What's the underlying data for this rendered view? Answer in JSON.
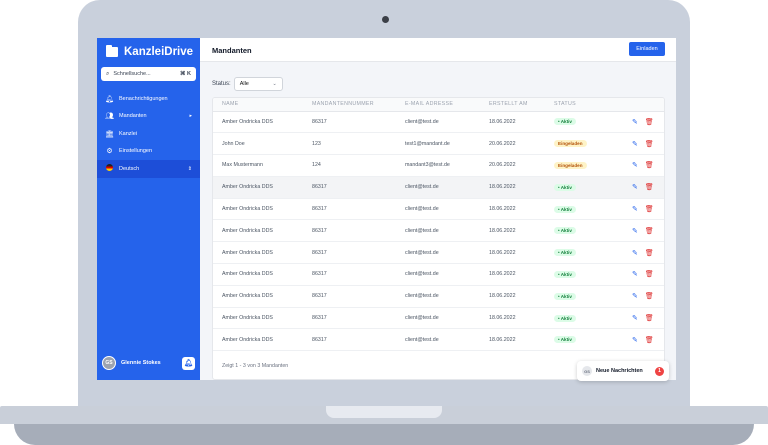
{
  "app": {
    "brand": "KanzleiDrive"
  },
  "search": {
    "placeholder": "Schnellsuche...",
    "shortcut": "⌘ K"
  },
  "sidebar": {
    "items": [
      {
        "label": "Benachrichtigungen",
        "icon": "bell-icon"
      },
      {
        "label": "Mandanten",
        "icon": "users-icon",
        "tail": "▸"
      },
      {
        "label": "Kanzlei",
        "icon": "building-icon"
      },
      {
        "label": "Einstellungen",
        "icon": "gear-icon"
      },
      {
        "label": "Deutsch",
        "icon": "german-flag-icon",
        "tail": "⇕"
      }
    ]
  },
  "user": {
    "initials": "GS",
    "name": "Glennie Stokes"
  },
  "header": {
    "title": "Mandanten",
    "invite_label": "Einladen"
  },
  "filter": {
    "label": "Status:",
    "value": "Alle"
  },
  "table": {
    "columns": [
      "NAME",
      "MANDANTENNUMMER",
      "E-MAIL ADRESSE",
      "ERSTELLT AM",
      "STATUS"
    ],
    "rows": [
      {
        "name": "Amber Ondricka DDS",
        "number": "86317",
        "email": "client@test.de",
        "created": "18.06.2022",
        "status": "• Aktiv",
        "type": "aktiv"
      },
      {
        "name": "John Doe",
        "number": "123",
        "email": "test1@mandant.de",
        "created": "20.06.2022",
        "status": "Eingeladen",
        "type": "eing"
      },
      {
        "name": "Max Mustermann",
        "number": "124",
        "email": "mandant3@test.de",
        "created": "20.06.2022",
        "status": "Eingeladen",
        "type": "eing"
      },
      {
        "name": "Amber Ondricka DDS",
        "number": "86317",
        "email": "client@test.de",
        "created": "18.06.2022",
        "status": "• Aktiv",
        "type": "aktiv"
      },
      {
        "name": "Amber Ondricka DDS",
        "number": "86317",
        "email": "client@test.de",
        "created": "18.06.2022",
        "status": "• Aktiv",
        "type": "aktiv"
      },
      {
        "name": "Amber Ondricka DDS",
        "number": "86317",
        "email": "client@test.de",
        "created": "18.06.2022",
        "status": "• Aktiv",
        "type": "aktiv"
      },
      {
        "name": "Amber Ondricka DDS",
        "number": "86317",
        "email": "client@test.de",
        "created": "18.06.2022",
        "status": "• Aktiv",
        "type": "aktiv"
      },
      {
        "name": "Amber Ondricka DDS",
        "number": "86317",
        "email": "client@test.de",
        "created": "18.06.2022",
        "status": "• Aktiv",
        "type": "aktiv"
      },
      {
        "name": "Amber Ondricka DDS",
        "number": "86317",
        "email": "client@test.de",
        "created": "18.06.2022",
        "status": "• Aktiv",
        "type": "aktiv"
      },
      {
        "name": "Amber Ondricka DDS",
        "number": "86317",
        "email": "client@test.de",
        "created": "18.06.2022",
        "status": "• Aktiv",
        "type": "aktiv"
      },
      {
        "name": "Amber Ondricka DDS",
        "number": "86317",
        "email": "client@test.de",
        "created": "18.06.2022",
        "status": "• Aktiv",
        "type": "aktiv"
      }
    ],
    "footer": "Zeigt 1 - 3 von 3 Mandanten"
  },
  "toast": {
    "initials": "GS",
    "label": "Neue Nachrichten",
    "count": "1"
  },
  "colors": {
    "accent": "#2563eb",
    "active_green": "#15803d",
    "invited_amber": "#b45309",
    "danger": "#dc2626"
  }
}
